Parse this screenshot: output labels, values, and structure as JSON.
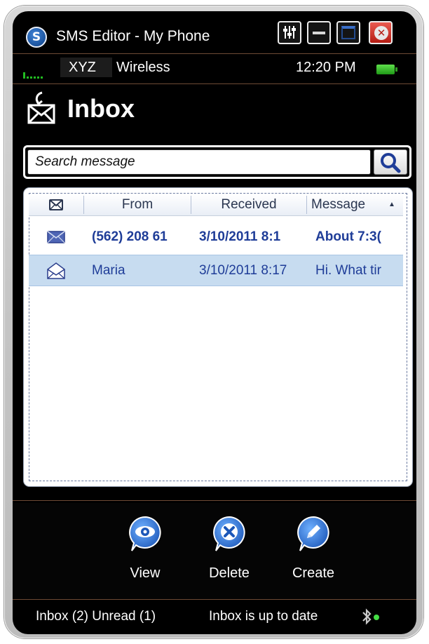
{
  "app": {
    "title": "SMS Editor - My Phone",
    "logo_letter": "S"
  },
  "window_controls": {
    "settings_icon": "settings-icon",
    "minimize_icon": "minimize-icon",
    "maximize_icon": "maximize-icon",
    "close_icon": "close-icon"
  },
  "status": {
    "carrier_name": "XYZ",
    "carrier_suffix": "Wireless",
    "time": "12:20 PM",
    "signal_color": "#22bb22",
    "battery_color": "#3cc42c"
  },
  "inbox": {
    "title": "Inbox"
  },
  "search": {
    "placeholder": "Search message",
    "value": ""
  },
  "table": {
    "columns": {
      "icon": "envelope-icon",
      "from": "From",
      "received": "Received",
      "message": "Message"
    },
    "sort_icon": "sort-ascending-icon",
    "rows": [
      {
        "from": "(562) 208 61",
        "received": "3/10/2011 8:1",
        "message": "About 7:3(",
        "status": "unread",
        "icon": "closed-envelope-icon"
      },
      {
        "from": "Maria",
        "received": "3/10/2011 8:17",
        "message": "Hi. What tir",
        "status": "read",
        "icon": "open-envelope-icon"
      }
    ],
    "selected_row": 1
  },
  "actions": {
    "view": "View",
    "delete": "Delete",
    "create": "Create"
  },
  "footer": {
    "counts": "Inbox (2) Unread (1)",
    "sync_status": "Inbox is up to date",
    "bluetooth_icon": "bluetooth-icon",
    "online_color": "#44dd44"
  },
  "colors": {
    "accent": "#1f3d98",
    "selection": "#c7dcf0",
    "close_red": "#d2382e"
  }
}
